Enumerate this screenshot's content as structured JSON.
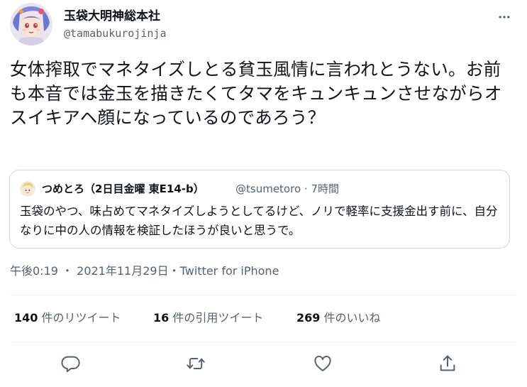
{
  "author": {
    "display_name": "玉袋大明神総本社",
    "handle": "@tamabukurojinja"
  },
  "tweet": {
    "text": "女体搾取でマネタイズしとる貧玉風情に言われとうない。お前も本音では金玉を描きたくてタマをキュンキュンさせながらオスイキアヘ顔になっているのであろう？"
  },
  "quoted_tweet": {
    "author_name": "つめとろ（2日目金曜 東E14-b）",
    "handle": "@tsumetoro",
    "separator": "·",
    "time": "7時間",
    "text": "玉袋のやつ、味占めてマネタイズしようとしてるけど、ノリで軽率に支援金出す前に、自分なりに中の人の情報を検証したほうが良いと思うで。"
  },
  "meta": {
    "time": "午後0:19",
    "dot1": "・",
    "date": "2021年11月29日",
    "dot2": "・",
    "source": "Twitter for iPhone"
  },
  "stats": {
    "retweets": {
      "count": "140",
      "label": "件のリツイート"
    },
    "quotes": {
      "count": "16",
      "label": "件の引用ツイート"
    },
    "likes": {
      "count": "269",
      "label": "件のいいね"
    }
  },
  "icons": {
    "more": "more-horizontal-icon",
    "reply": "reply-icon",
    "retweet": "retweet-icon",
    "like": "heart-icon",
    "share": "share-icon"
  },
  "colors": {
    "text_primary": "#0f1419",
    "text_secondary": "#536471",
    "border": "#cfd9de",
    "divider": "#eff3f4"
  }
}
